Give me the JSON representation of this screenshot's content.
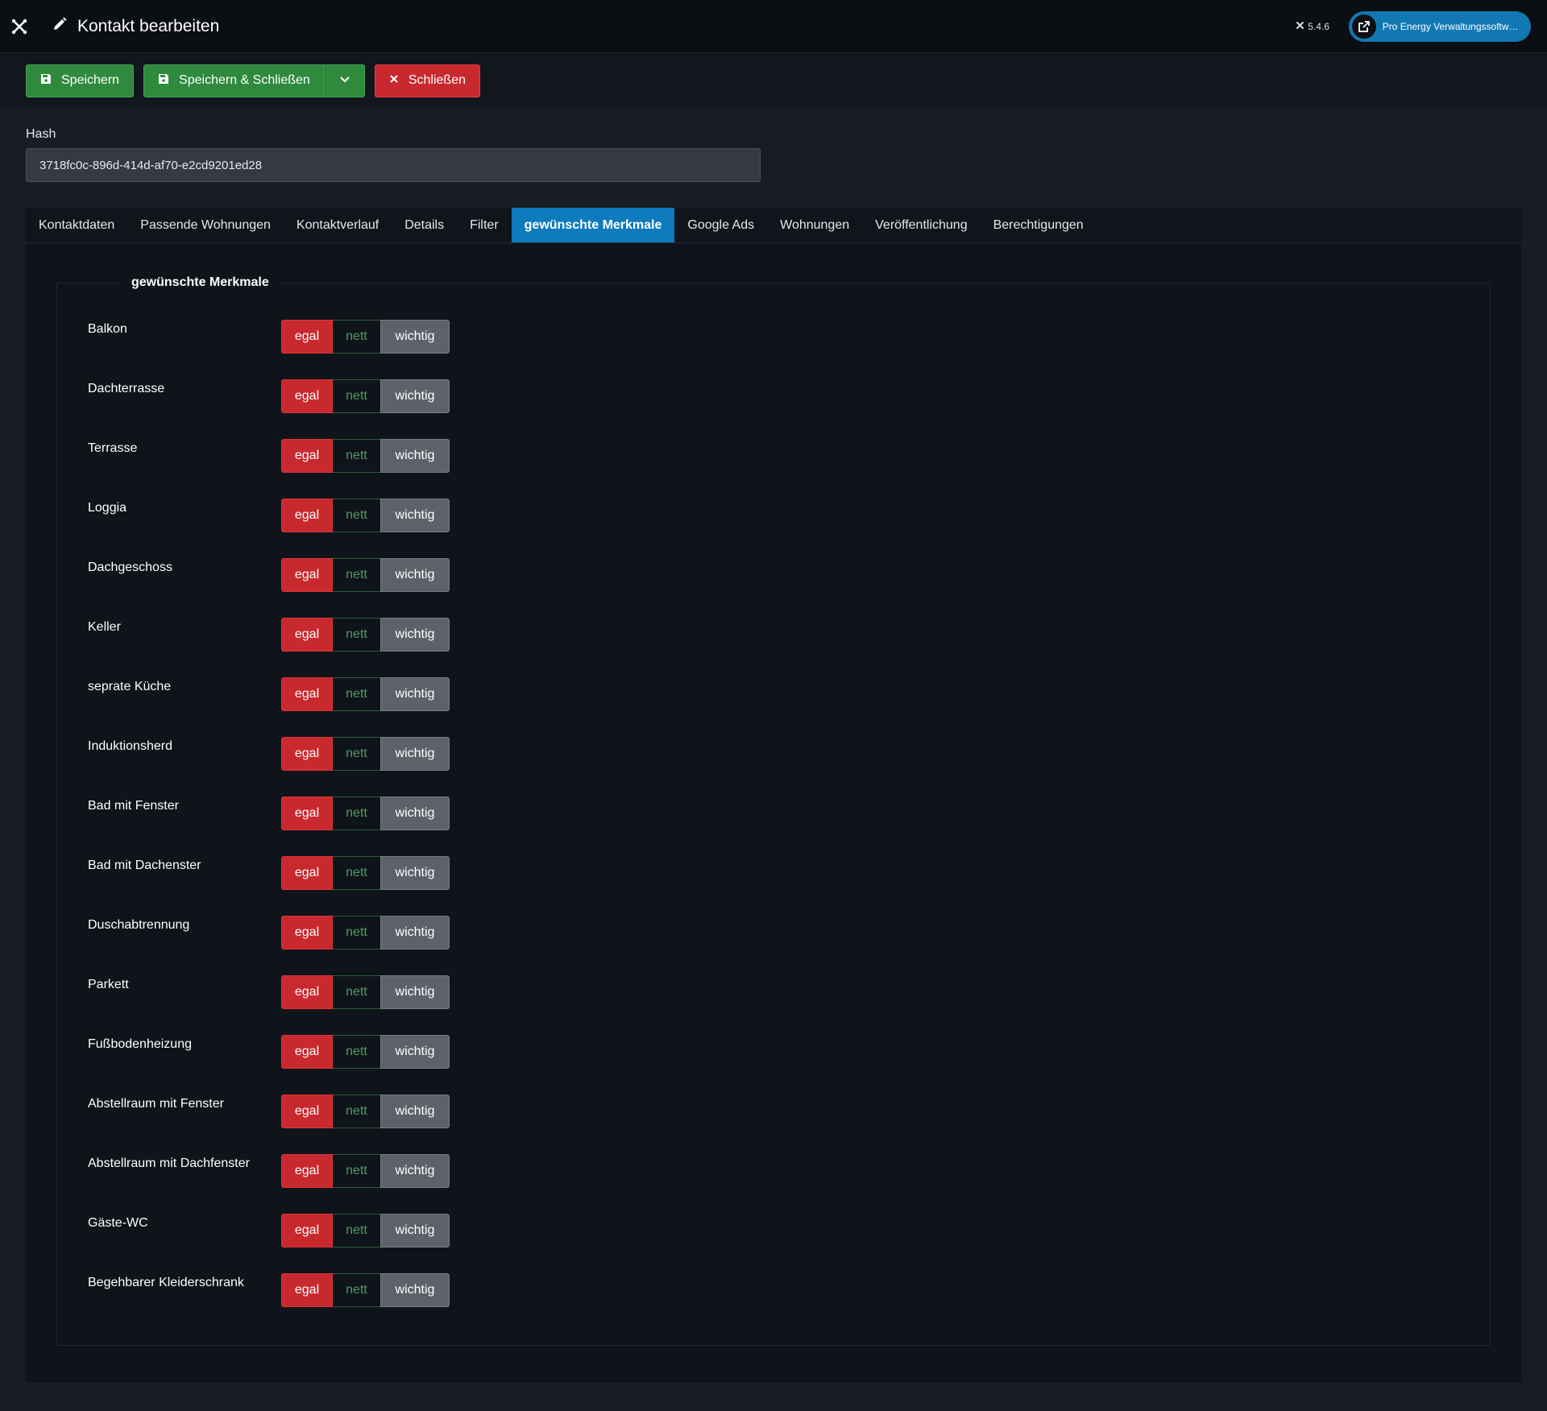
{
  "header": {
    "title": "Kontakt bearbeiten",
    "version": "5.4.6",
    "site_button_label": "Pro Energy Verwaltungssoftwa..."
  },
  "toolbar": {
    "save_label": "Speichern",
    "save_close_label": "Speichern & Schließen",
    "close_label": "Schließen"
  },
  "form": {
    "hash_label": "Hash",
    "hash_value": "3718fc0c-896d-414d-af70-e2cd9201ed28"
  },
  "tabs": [
    {
      "label": "Kontaktdaten"
    },
    {
      "label": "Passende Wohnungen"
    },
    {
      "label": "Kontaktverlauf"
    },
    {
      "label": "Details"
    },
    {
      "label": "Filter"
    },
    {
      "label": "gewünschte Merkmale"
    },
    {
      "label": "Google Ads"
    },
    {
      "label": "Wohnungen"
    },
    {
      "label": "Veröffentlichung"
    },
    {
      "label": "Berechtigungen"
    }
  ],
  "active_tab": "gewünschte Merkmale",
  "fieldset": {
    "legend": "gewünschte Merkmale",
    "options": {
      "egal": "egal",
      "nett": "nett",
      "wichtig": "wichtig"
    },
    "items": [
      {
        "label": "Balkon",
        "selected": "egal"
      },
      {
        "label": "Dachterrasse",
        "selected": "egal"
      },
      {
        "label": "Terrasse",
        "selected": "egal"
      },
      {
        "label": "Loggia",
        "selected": "egal"
      },
      {
        "label": "Dachgeschoss",
        "selected": "egal"
      },
      {
        "label": "Keller",
        "selected": "egal"
      },
      {
        "label": "seprate Küche",
        "selected": "egal"
      },
      {
        "label": "Induktionsherd",
        "selected": "egal"
      },
      {
        "label": "Bad mit Fenster",
        "selected": "egal"
      },
      {
        "label": "Bad mit Dachenster",
        "selected": "egal"
      },
      {
        "label": "Duschabtrennung",
        "selected": "egal"
      },
      {
        "label": "Parkett",
        "selected": "egal"
      },
      {
        "label": "Fußbodenheizung",
        "selected": "egal"
      },
      {
        "label": "Abstellraum mit Fenster",
        "selected": "egal"
      },
      {
        "label": "Abstellraum mit Dachfenster",
        "selected": "egal"
      },
      {
        "label": "Gäste-WC",
        "selected": "egal"
      },
      {
        "label": "Begehbarer Kleiderschrank",
        "selected": "egal"
      }
    ]
  },
  "colors": {
    "accent": "#0e7bbd",
    "success": "#2f8a3d",
    "danger": "#c8292f",
    "background": "#181c24"
  }
}
